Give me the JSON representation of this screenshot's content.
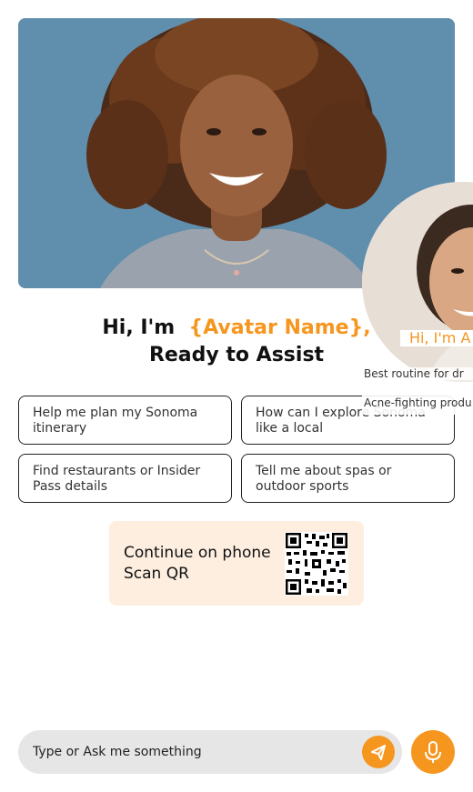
{
  "hero": {
    "alt": "Smiling young woman with curly hair against a blue background"
  },
  "greeting": {
    "line1_prefix": "Hi, I'm",
    "avatar_name": "{Avatar Name},",
    "line2": "Ready to Assist"
  },
  "suggestions": [
    {
      "label": "Help me plan my Sonoma itinerary"
    },
    {
      "label": "How can I explore Sonoma like a local"
    },
    {
      "label": "Find restaurants or Insider Pass details"
    },
    {
      "label": "Tell me about spas or outdoor sports"
    }
  ],
  "qr": {
    "line1": "Continue on phone",
    "line2": "Scan QR"
  },
  "chat": {
    "placeholder": "Type or Ask me something"
  },
  "overlay": {
    "greeting": "Hi, I'm A",
    "suggestion_1": "Best routine for dr",
    "suggestion_2": "Acne-fighting produ"
  },
  "colors": {
    "accent": "#f5961f",
    "qr_box_bg": "#fdeee0",
    "chat_bg": "#e6e6e6",
    "hero_bg": "#5b89a8"
  },
  "icons": {
    "send": "paper-plane-icon",
    "mic": "microphone-icon"
  }
}
